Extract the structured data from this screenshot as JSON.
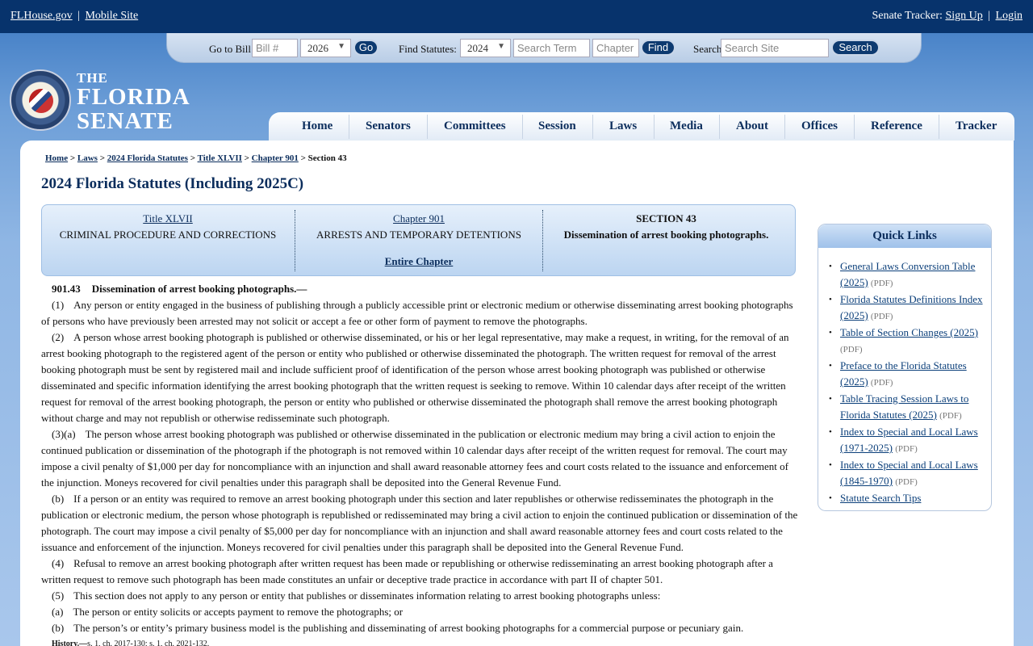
{
  "topbar": {
    "flhouse": "FLHouse.gov",
    "sep": "|",
    "mobile": "Mobile Site",
    "tracker_label": "Senate Tracker:",
    "signup": "Sign Up",
    "sep2": "|",
    "login": "Login"
  },
  "searchbar": {
    "goto_label": "Go to Bill:",
    "bill_placeholder": "Bill #",
    "bill_year": "2026",
    "go": "Go",
    "find_label": "Find Statutes:",
    "statute_year": "2024",
    "term_placeholder": "Search Term",
    "chapter_placeholder": "Chapter",
    "find": "Find",
    "search_label": "Search",
    "site_placeholder": "Search Site",
    "search": "Search"
  },
  "logo": {
    "the": "THE",
    "florida": "FLORIDA",
    "senate": "SENATE"
  },
  "nav": [
    "Home",
    "Senators",
    "Committees",
    "Session",
    "Laws",
    "Media",
    "About",
    "Offices",
    "Reference",
    "Tracker"
  ],
  "breadcrumb": {
    "home": "Home",
    "laws": "Laws",
    "statutes": "2024 Florida Statutes",
    "title": "Title XLVII",
    "chapter": "Chapter 901",
    "current": "Section 43",
    "sep": ">"
  },
  "page_title": "2024 Florida Statutes (Including 2025C)",
  "infobox": {
    "title_link": "Title XLVII",
    "title_name": "CRIMINAL PROCEDURE AND CORRECTIONS",
    "chapter_link": "Chapter 901",
    "chapter_name": "ARRESTS AND TEMPORARY DETENTIONS",
    "entire_chapter": "Entire Chapter",
    "section_label": "SECTION 43",
    "section_name": "Dissemination of arrest booking photographs."
  },
  "statute": {
    "number": "901.43",
    "catchline": "Dissemination of arrest booking photographs.—",
    "p1_label": "(1)",
    "p1": "Any person or entity engaged in the business of publishing through a publicly accessible print or electronic medium or otherwise disseminating arrest booking photographs of persons who have previously been arrested may not solicit or accept a fee or other form of payment to remove the photographs.",
    "p2_label": "(2)",
    "p2": "A person whose arrest booking photograph is published or otherwise disseminated, or his or her legal representative, may make a request, in writing, for the removal of an arrest booking photograph to the registered agent of the person or entity who published or otherwise disseminated the photograph. The written request for removal of the arrest booking photograph must be sent by registered mail and include sufficient proof of identification of the person whose arrest booking photograph was published or otherwise disseminated and specific information identifying the arrest booking photograph that the written request is seeking to remove. Within 10 calendar days after receipt of the written request for removal of the arrest booking photograph, the person or entity who published or otherwise disseminated the photograph shall remove the arrest booking photograph without charge and may not republish or otherwise redisseminate such photograph.",
    "p3a_label": "(3)(a)",
    "p3a": "The person whose arrest booking photograph was published or otherwise disseminated in the publication or electronic medium may bring a civil action to enjoin the continued publication or dissemination of the photograph if the photograph is not removed within 10 calendar days after receipt of the written request for removal. The court may impose a civil penalty of $1,000 per day for noncompliance with an injunction and shall award reasonable attorney fees and court costs related to the issuance and enforcement of the injunction. Moneys recovered for civil penalties under this paragraph shall be deposited into the General Revenue Fund.",
    "p3b_label": "(b)",
    "p3b": "If a person or an entity was required to remove an arrest booking photograph under this section and later republishes or otherwise redisseminates the photograph in the publication or electronic medium, the person whose photograph is republished or redisseminated may bring a civil action to enjoin the continued publication or dissemination of the photograph. The court may impose a civil penalty of $5,000 per day for noncompliance with an injunction and shall award reasonable attorney fees and court costs related to the issuance and enforcement of the injunction. Moneys recovered for civil penalties under this paragraph shall be deposited into the General Revenue Fund.",
    "p4_label": "(4)",
    "p4": "Refusal to remove an arrest booking photograph after written request has been made or republishing or otherwise redisseminating an arrest booking photograph after a written request to remove such photograph has been made constitutes an unfair or deceptive trade practice in accordance with part II of chapter 501.",
    "p5_label": "(5)",
    "p5": "This section does not apply to any person or entity that publishes or disseminates information relating to arrest booking photographs unless:",
    "p5a_label": "(a)",
    "p5a": "The person or entity solicits or accepts payment to remove the photographs; or",
    "p5b_label": "(b)",
    "p5b": "The person’s or entity’s primary business model is the publishing and disseminating of arrest booking photographs for a commercial purpose or pecuniary gain.",
    "history_label": "History.—",
    "history": "s. 1, ch. 2017-130; s. 1, ch. 2021-132."
  },
  "quicklinks": {
    "title": "Quick Links",
    "items": [
      {
        "label": "General Laws Conversion Table (2025)",
        "pdf": "(PDF)"
      },
      {
        "label": "Florida Statutes Definitions Index (2025)",
        "pdf": "(PDF)"
      },
      {
        "label": "Table of Section Changes (2025)",
        "pdf": "(PDF)"
      },
      {
        "label": "Preface to the Florida Statutes (2025)",
        "pdf": "(PDF)"
      },
      {
        "label": "Table Tracing Session Laws to Florida Statutes (2025)",
        "pdf": "(PDF)"
      },
      {
        "label": "Index to Special and Local Laws (1971-2025)",
        "pdf": "(PDF)"
      },
      {
        "label": "Index to Special and Local Laws (1845-1970)",
        "pdf": "(PDF)"
      },
      {
        "label": "Statute Search Tips",
        "pdf": ""
      }
    ]
  }
}
